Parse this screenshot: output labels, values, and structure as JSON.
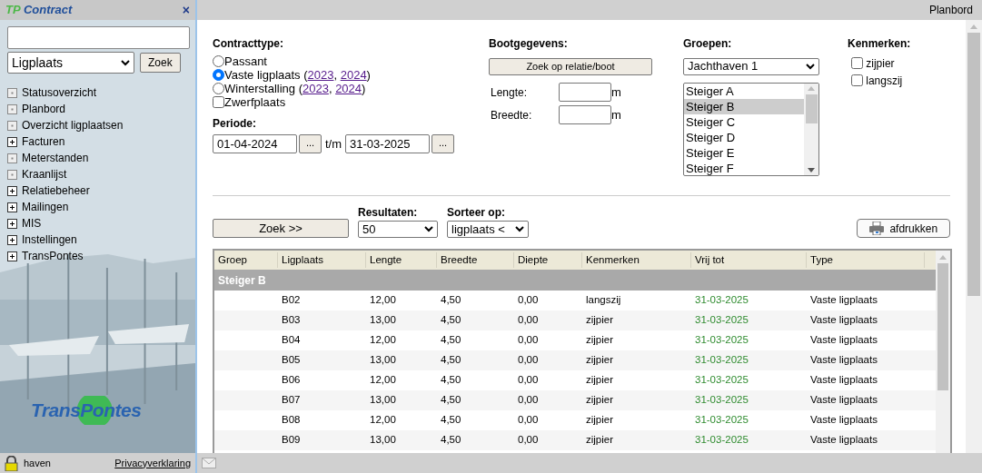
{
  "sidebar": {
    "title_prefix": "TP",
    "title": "Contract",
    "close": "×",
    "search_type": "Ligplaats",
    "search_button": "Zoek",
    "menu": [
      {
        "label": "Statusoverzicht",
        "kind": "leaf"
      },
      {
        "label": "Planbord",
        "kind": "leaf"
      },
      {
        "label": "Overzicht ligplaatsen",
        "kind": "leaf"
      },
      {
        "label": "Facturen",
        "kind": "folder"
      },
      {
        "label": "Meterstanden",
        "kind": "leaf"
      },
      {
        "label": "Kraanlijst",
        "kind": "leaf"
      },
      {
        "label": "Relatiebeheer",
        "kind": "folder"
      },
      {
        "label": "Mailingen",
        "kind": "folder"
      },
      {
        "label": "MIS",
        "kind": "folder"
      },
      {
        "label": "Instellingen",
        "kind": "folder"
      },
      {
        "label": "TransPontes",
        "kind": "folder"
      }
    ],
    "logo": "TransPontes",
    "user": "haven",
    "privacy": "Privacyverklaring"
  },
  "page_title": "Planbord",
  "contracttype": {
    "heading": "Contracttype:",
    "options": [
      {
        "kind": "radio",
        "selected": false,
        "parts": [
          {
            "text": "Passant"
          }
        ]
      },
      {
        "kind": "radio",
        "selected": true,
        "parts": [
          {
            "text": "Vaste ligplaats ("
          },
          {
            "link": "2023"
          },
          {
            "text": ", "
          },
          {
            "link": "2024"
          },
          {
            "text": ")"
          }
        ]
      },
      {
        "kind": "radio",
        "selected": false,
        "parts": [
          {
            "text": "Winterstalling ("
          },
          {
            "link": "2023"
          },
          {
            "text": ", "
          },
          {
            "link": "2024"
          },
          {
            "text": ")"
          }
        ]
      },
      {
        "kind": "checkbox",
        "selected": false,
        "parts": [
          {
            "text": "Zwerfplaats"
          }
        ]
      }
    ]
  },
  "periode": {
    "heading": "Periode:",
    "from": "01-04-2024",
    "picker": "...",
    "separator": "t/m",
    "to": "31-03-2025",
    "picker2": "..."
  },
  "bootgegevens": {
    "heading": "Bootgegevens:",
    "button": "Zoek op relatie/boot",
    "fields": [
      {
        "label": "Lengte:",
        "unit": "m"
      },
      {
        "label": "Breedte:",
        "unit": "m"
      }
    ]
  },
  "groepen": {
    "heading": "Groepen:",
    "dropdown": "Jachthaven 1",
    "items": [
      {
        "label": "Steiger A",
        "selected": false
      },
      {
        "label": "Steiger B",
        "selected": true
      },
      {
        "label": "Steiger C",
        "selected": false
      },
      {
        "label": "Steiger D",
        "selected": false
      },
      {
        "label": "Steiger E",
        "selected": false
      },
      {
        "label": "Steiger F",
        "selected": false
      }
    ]
  },
  "kenmerken": {
    "heading": "Kenmerken:",
    "options": [
      {
        "label": "zijpier",
        "checked": false
      },
      {
        "label": "langszij",
        "checked": false
      }
    ]
  },
  "search_button": "Zoek >>",
  "resultaten": {
    "heading": "Resultaten:",
    "value": "50"
  },
  "sorteer": {
    "heading": "Sorteer op:",
    "value": "ligplaats <"
  },
  "print_button": "afdrukken",
  "table": {
    "columns": [
      "Groep",
      "Ligplaats",
      "Lengte",
      "Breedte",
      "Diepte",
      "Kenmerken",
      "Vrij tot",
      "Type"
    ],
    "group": "Steiger B",
    "rows": [
      [
        "",
        "B02",
        "12,00",
        "4,50",
        "0,00",
        "langszij",
        "31-03-2025",
        "Vaste ligplaats"
      ],
      [
        "",
        "B03",
        "13,00",
        "4,50",
        "0,00",
        "zijpier",
        "31-03-2025",
        "Vaste ligplaats"
      ],
      [
        "",
        "B04",
        "12,00",
        "4,50",
        "0,00",
        "zijpier",
        "31-03-2025",
        "Vaste ligplaats"
      ],
      [
        "",
        "B05",
        "13,00",
        "4,50",
        "0,00",
        "zijpier",
        "31-03-2025",
        "Vaste ligplaats"
      ],
      [
        "",
        "B06",
        "12,00",
        "4,50",
        "0,00",
        "zijpier",
        "31-03-2025",
        "Vaste ligplaats"
      ],
      [
        "",
        "B07",
        "13,00",
        "4,50",
        "0,00",
        "zijpier",
        "31-03-2025",
        "Vaste ligplaats"
      ],
      [
        "",
        "B08",
        "12,00",
        "4,50",
        "0,00",
        "zijpier",
        "31-03-2025",
        "Vaste ligplaats"
      ],
      [
        "",
        "B09",
        "13,00",
        "4,50",
        "0,00",
        "zijpier",
        "31-03-2025",
        "Vaste ligplaats"
      ]
    ]
  }
}
